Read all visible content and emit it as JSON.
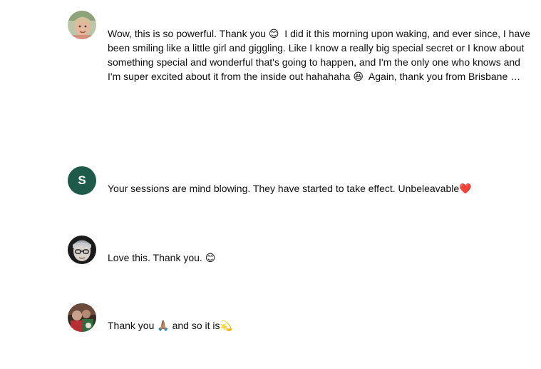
{
  "comments": [
    {
      "avatar": {
        "kind": "photo",
        "icon": "user-photo-avatar"
      },
      "text": "Wow, this is so powerful. Thank you 😊  I did it this morning upon waking, and ever since, I have been smiling like a little girl and giggling. Like I know a really big special secret or I know about something special and wonderful that's going to happen, and I'm the only one who knows and I'm super excited about it from the inside out hahahaha 😆  Again, thank you from Brisbane …"
    },
    {
      "avatar": {
        "kind": "letter",
        "letter": "S",
        "color": "#1e5a4a"
      },
      "text": "Your sessions are mind blowing. They have started to take effect. Unbeleavable❤️"
    },
    {
      "avatar": {
        "kind": "photo",
        "icon": "user-photo-avatar"
      },
      "text": "Love this. Thank you. 😊"
    },
    {
      "avatar": {
        "kind": "photo",
        "icon": "user-photo-avatar"
      },
      "text": "Thank you 🙏🏽 and so it is💫"
    }
  ]
}
